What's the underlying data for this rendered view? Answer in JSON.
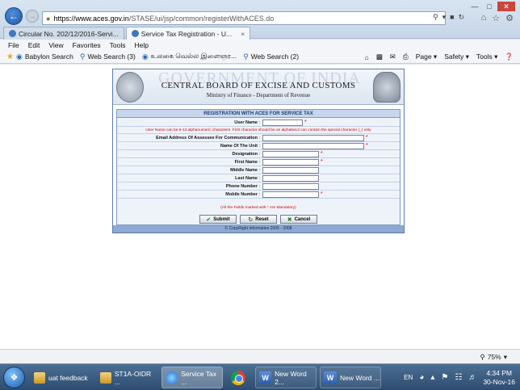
{
  "browser": {
    "url_host": "https://www.aces.gov.in",
    "url_path": "/STASE/ui/jsp/common/registerWithACES.do",
    "tabs": [
      {
        "label": "Circular No. 202/12/2016-Servi...",
        "active": false
      },
      {
        "label": "Service Tax Registration - U...",
        "active": true,
        "close": "×"
      }
    ],
    "menu": [
      "File",
      "Edit",
      "View",
      "Favorites",
      "Tools",
      "Help"
    ],
    "favorites": [
      "Babylon Search",
      "Web Search (3)",
      "உலகை வெல்ல இளைஞர...",
      "Web Search (2)"
    ],
    "toolbar_right": [
      "Page ▾",
      "Safety ▾",
      "Tools ▾"
    ],
    "zoom": "75%"
  },
  "page": {
    "watermark": "GOVERNMENT OF INDIA",
    "org_name": "CENTRAL BOARD OF EXCISE AND CUSTOMS",
    "ministry": "Ministry of Finance - Department of Revenue",
    "form_title": "REGISTRATION WITH ACES FOR SERVICE TAX",
    "username_note": "User Name can be 6-12 alphanumeric characters. First character should be an alphabet,it can contain the special character (_) only",
    "mandatory_note": "(All the Fields marked with * Are Mandatory)",
    "fields": [
      {
        "label": "User Name",
        "required": true
      },
      {
        "label": "Email Address Of Assessee For Communication",
        "required": true
      },
      {
        "label": "Name Of The Unit",
        "required": true
      },
      {
        "label": "Designation",
        "required": true
      },
      {
        "label": "First Name",
        "required": true
      },
      {
        "label": "Middle Name",
        "required": false
      },
      {
        "label": "Last Name",
        "required": false
      },
      {
        "label": "Phone Number",
        "required": false
      },
      {
        "label": "Mobile Number",
        "required": true
      }
    ],
    "buttons": {
      "submit": "Submit",
      "reset": "Reset",
      "cancel": "Cancel"
    },
    "footer": "© CopyRight Information 2005 - 2008"
  },
  "taskbar": {
    "items": [
      "uat feedback",
      "ST1A-OIDR ...",
      "Service Tax ...",
      "New Word 2...",
      "New Word ..."
    ],
    "lang": "EN",
    "time": "4:34 PM",
    "date": "30-Nov-16"
  }
}
